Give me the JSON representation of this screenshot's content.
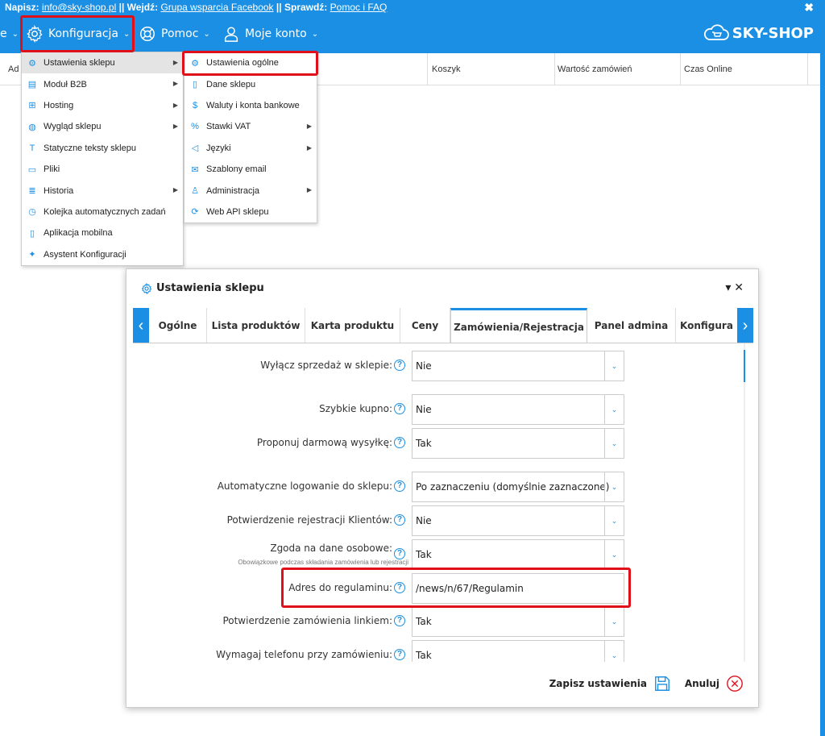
{
  "topbar": {
    "write_label": "Napisz:",
    "email": "info@sky-shop.pl",
    "sep1": "||",
    "enter_label": "Wejdź:",
    "facebook": "Grupa wsparcia Facebook",
    "sep2": "||",
    "check_label": "Sprawdź:",
    "help_link": "Pomoc i FAQ",
    "close": "✖"
  },
  "nav": {
    "partial": "e",
    "config": "Konfiguracja",
    "help": "Pomoc",
    "account": "Moje konto",
    "brand": "SKY-SHOP"
  },
  "table": {
    "col_partial": "Ad",
    "cols": [
      "Koszyk",
      "Wartość zamówień",
      "Czas Online"
    ]
  },
  "menu_main": [
    {
      "label": "Ustawienia sklepu",
      "icon": "gear-icon",
      "sub": true
    },
    {
      "label": "Moduł B2B",
      "icon": "store-icon",
      "sub": true
    },
    {
      "label": "Hosting",
      "icon": "network-icon",
      "sub": true
    },
    {
      "label": "Wygląd sklepu",
      "icon": "palette-icon",
      "sub": true
    },
    {
      "label": "Statyczne teksty sklepu",
      "icon": "text-icon",
      "sub": false
    },
    {
      "label": "Pliki",
      "icon": "folder-icon",
      "sub": false
    },
    {
      "label": "Historia",
      "icon": "log-icon",
      "sub": true
    },
    {
      "label": "Kolejka automatycznych zadań",
      "icon": "clock-icon",
      "sub": false
    },
    {
      "label": "Aplikacja mobilna",
      "icon": "phone-icon",
      "sub": false
    },
    {
      "label": "Asystent Konfiguracji",
      "icon": "wand-icon",
      "sub": false
    }
  ],
  "menu_sub": [
    {
      "label": "Ustawienia ogólne",
      "icon": "gear-icon",
      "sub": false
    },
    {
      "label": "Dane sklepu",
      "icon": "document-icon",
      "sub": false
    },
    {
      "label": "Waluty i konta bankowe",
      "icon": "currency-icon",
      "sub": false
    },
    {
      "label": "Stawki VAT",
      "icon": "vat-icon",
      "sub": true
    },
    {
      "label": "Języki",
      "icon": "speaker-icon",
      "sub": true
    },
    {
      "label": "Szablony email",
      "icon": "email-icon",
      "sub": false
    },
    {
      "label": "Administracja",
      "icon": "admin-icon",
      "sub": true
    },
    {
      "label": "Web API sklepu",
      "icon": "api-icon",
      "sub": false
    }
  ],
  "dialog": {
    "title": "Ustawienia sklepu",
    "controls": "▾ ✕",
    "tabs": [
      "Ogólne",
      "Lista produktów",
      "Karta produktu",
      "Ceny",
      "Zamówienia/Rejestracja",
      "Panel admina",
      "Konfigura"
    ],
    "active_tab": "Zamówienia/Rejestracja",
    "fields": [
      {
        "label": "Wyłącz sprzedaż w sklepie:",
        "value": "Nie",
        "type": "select"
      },
      {
        "label": "Szybkie kupno:",
        "value": "Nie",
        "type": "select"
      },
      {
        "label": "Proponuj darmową wysyłkę:",
        "value": "Tak",
        "type": "select"
      },
      {
        "label": "Automatyczne logowanie do sklepu:",
        "value": "Po zaznaczeniu (domyślnie zaznaczone)",
        "type": "select"
      },
      {
        "label": "Potwierdzenie rejestracji Klientów:",
        "value": "Nie",
        "type": "select"
      },
      {
        "label": "Zgoda na dane osobowe:",
        "sublabel": "Obowiązkowe podczas składania zamówienia lub rejestracji",
        "value": "Tak",
        "type": "select"
      },
      {
        "label": "Adres do regulaminu:",
        "value": "/news/n/67/Regulamin",
        "type": "input"
      },
      {
        "label": "Potwierdzenie zamówienia linkiem:",
        "value": "Tak",
        "type": "select"
      },
      {
        "label": "Wymagaj telefonu przy zamówieniu:",
        "value": "Tak",
        "type": "select"
      }
    ],
    "save": "Zapisz ustawienia",
    "cancel": "Anuluj"
  },
  "colors": {
    "accent": "#1a8fe3",
    "highlight": "#e0101a"
  }
}
